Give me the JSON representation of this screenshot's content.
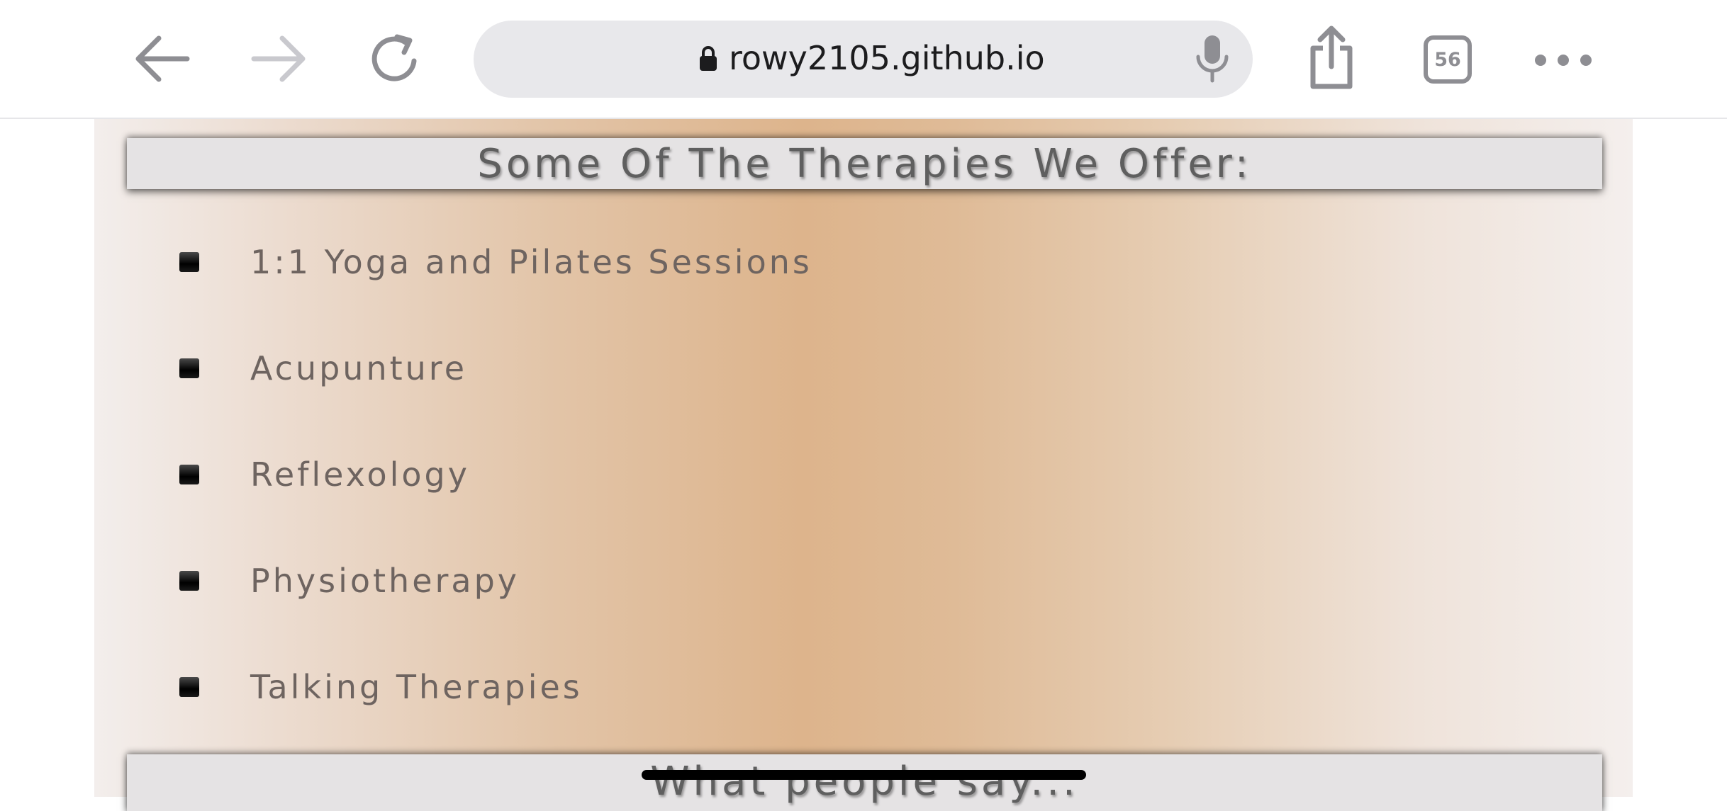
{
  "browser": {
    "url": "rowy2105.github.io",
    "tab_count": "56",
    "icons": {
      "back": "back-arrow-icon",
      "forward": "forward-arrow-icon",
      "reload": "reload-icon",
      "lock": "lock-icon",
      "mic": "microphone-icon",
      "share": "share-icon",
      "more": "more-icon"
    }
  },
  "page": {
    "therapies_heading": "Some Of The Therapies We Offer:",
    "therapies": [
      "1:1 Yoga and Pilates Sessions",
      "Acupunture",
      "Reflexology",
      "Physiotherapy",
      "Talking Therapies"
    ],
    "testimonials_heading": "What people say..."
  },
  "colors": {
    "heading_bar": "#e5e3e4",
    "heading_text": "#5f5f5f",
    "list_text": "#6e6460",
    "gradient_center": "#ddb48c"
  }
}
